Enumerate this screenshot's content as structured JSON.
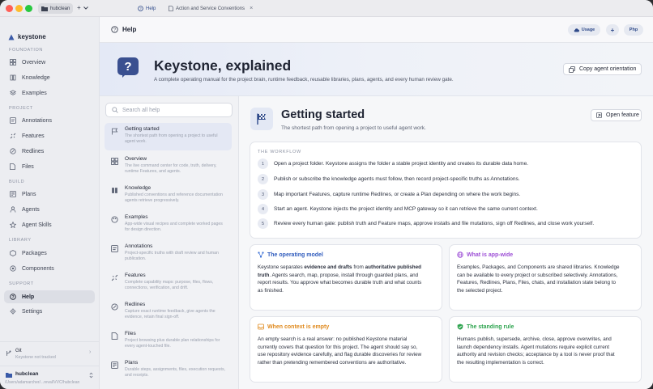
{
  "colors": {
    "accent": "#2f4a8a",
    "red": "#ff5f57",
    "yellow": "#febc2e",
    "green": "#28c840",
    "blue": "#3b6fd6",
    "purple": "#9d4fd6",
    "orange": "#e08a1e",
    "check": "#2ea44f"
  },
  "titlebar": {
    "workspace": "hubclean",
    "tab_help": "Help",
    "tab_doc": "Action and Service Conventions"
  },
  "sidebar": {
    "brand": "keystone",
    "sections": {
      "foundation": "FOUNDATION",
      "project": "PROJECT",
      "build": "BUILD",
      "library": "LIBRARY",
      "support": "SUPPORT"
    },
    "items": {
      "overview": "Overview",
      "knowledge": "Knowledge",
      "examples": "Examples",
      "annotations": "Annotations",
      "features": "Features",
      "redlines": "Redlines",
      "files": "Files",
      "plans": "Plans",
      "agents": "Agents",
      "agent_skills": "Agent Skills",
      "packages": "Packages",
      "components": "Components",
      "help": "Help",
      "settings": "Settings"
    },
    "git_title": "Git",
    "git_status": "Keystone not tracked",
    "workspace_name": "hubclean",
    "workspace_path": "/Users/adamarcher/...reval/VVC/hubclean"
  },
  "topbar": {
    "title": "Help",
    "usage": "Usage",
    "plus": "+",
    "php": "Php"
  },
  "hero": {
    "title": "Keystone, explained",
    "subtitle": "A complete operating manual for the project brain, runtime feedback, reusable libraries, plans, agents, and every human review gate.",
    "copy_button": "Copy agent orientation"
  },
  "list": {
    "search_placeholder": "Search all help",
    "items": [
      {
        "title": "Getting started",
        "desc": "The shortest path from opening a project to useful agent work."
      },
      {
        "title": "Overview",
        "desc": "The live command center for code, truth, delivery, runtime Features, and agents."
      },
      {
        "title": "Knowledge",
        "desc": "Published conventions and reference documentation agents retrieve progressively."
      },
      {
        "title": "Examples",
        "desc": "App-wide visual recipes and complete worked pages for design direction."
      },
      {
        "title": "Annotations",
        "desc": "Project-specific truths with draft review and human publication."
      },
      {
        "title": "Features",
        "desc": "Complete capability maps: purpose, files, flows, connections, verification, and drift."
      },
      {
        "title": "Redlines",
        "desc": "Capture exact runtime feedback, give agents the evidence, retain final sign-off."
      },
      {
        "title": "Files",
        "desc": "Project browsing plus durable plan relationships for every agent-touched file."
      },
      {
        "title": "Plans",
        "desc": "Durable steps, assignments, files, execution requests, and receipts."
      }
    ]
  },
  "content": {
    "title": "Getting started",
    "subtitle": "The shortest path from opening a project to useful agent work.",
    "open_feature": "Open feature",
    "workflow_label": "THE WORKFLOW",
    "steps": [
      {
        "n": "1",
        "text": "Open a project folder. Keystone assigns the folder a stable project identity and creates its durable data home."
      },
      {
        "n": "2",
        "text": "Publish or subscribe the knowledge agents must follow, then record project-specific truths as Annotations."
      },
      {
        "n": "3",
        "text": "Map important Features, capture runtime Redlines, or create a Plan depending on where the work begins."
      },
      {
        "n": "4",
        "text": "Start an agent. Keystone injects the project identity and MCP gateway so it can retrieve the same current context."
      },
      {
        "n": "5",
        "text": "Review every human gate: publish truth and Feature maps, approve installs and file mutations, sign off Redlines, and close work yourself."
      }
    ],
    "cards": {
      "operating": {
        "title": "The operating model",
        "l1a": "Keystone separates ",
        "l1b": "evidence and drafts",
        "l1c": " from ",
        "l1d": "authoritative published",
        "l2a": "truth",
        "l2b": ". Agents search, map, propose, install through guarded plans, and",
        "l3": "report results. You approve what becomes durable truth and what counts",
        "l4": "as finished."
      },
      "appwide": {
        "title": "What is app-wide",
        "l1": "Examples, Packages, and Components are shared libraries. Knowledge",
        "l2": "can be available to every project or subscribed selectively. Annotations,",
        "l3": "Features, Redlines, Plans, Files, chats, and installation state belong to",
        "l4": "the selected project."
      },
      "empty": {
        "title": "When context is empty",
        "l1": "An empty search is a real answer: no published Keystone material",
        "l2": "currently covers that question for this project. The agent should say so,",
        "l3": "use repository evidence carefully, and flag durable discoveries for review",
        "l4": "rather than pretending remembered conventions are authoritative."
      },
      "rule": {
        "title": "The standing rule",
        "l1": "Humans publish, supersede, archive, close, approve overwrites, and",
        "l2": "launch dependency installs. Agent mutations require explicit current",
        "l3": "authority and revision checks; acceptance by a tool is never proof that",
        "l4": "the resulting implementation is correct."
      }
    }
  }
}
